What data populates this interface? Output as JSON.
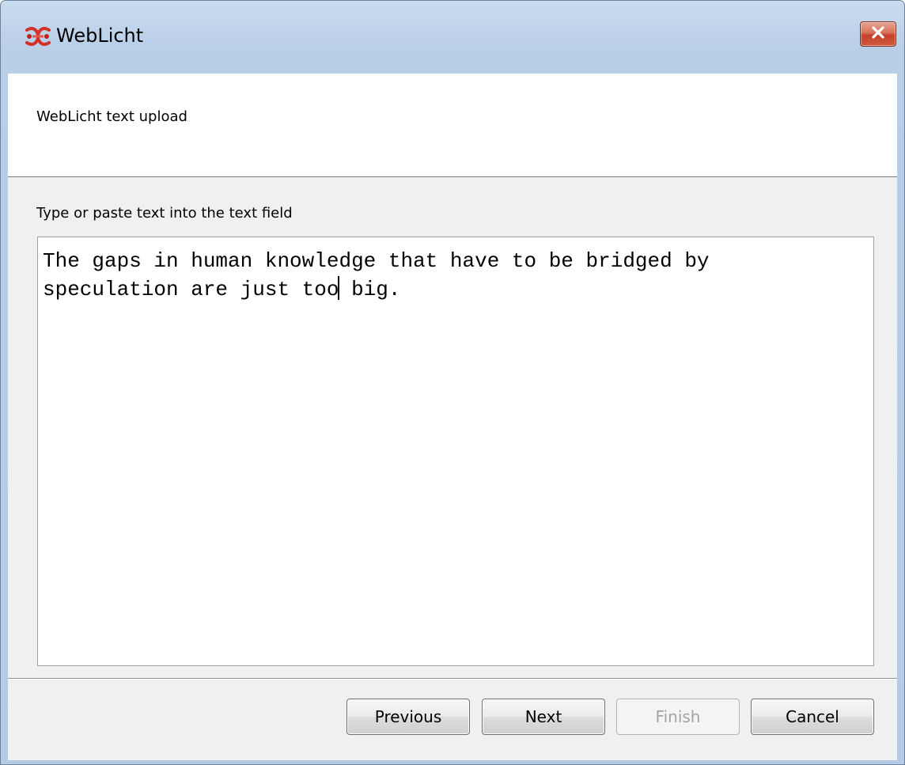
{
  "window": {
    "title": "WebLicht",
    "app_icon": "weblicht-logo-icon",
    "close_icon": "close-icon"
  },
  "header": {
    "label": "WebLicht text upload"
  },
  "content": {
    "instruction": "Type or paste text into the text field",
    "text_before_caret": "The gaps in human knowledge that have to be bridged by\nspeculation are just too",
    "text_after_caret": " big."
  },
  "buttons": {
    "previous": "Previous",
    "next": "Next",
    "finish": "Finish",
    "cancel": "Cancel"
  },
  "colors": {
    "frame": "#b9cfe8",
    "close_button": "#c4412c",
    "dialog_background": "#f0f0f0"
  }
}
